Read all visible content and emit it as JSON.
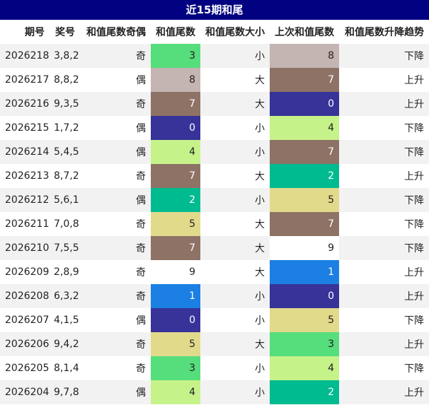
{
  "title": "近15期和尾",
  "headers": [
    "期号",
    "奖号",
    "和值尾数奇偶",
    "和值尾数",
    "和值尾数大小",
    "上次和值尾数",
    "和值尾数升降趋势"
  ],
  "digit_colors": {
    "0": "#373399",
    "1": "#1b7fe3",
    "2": "#00bb8f",
    "3": "#56dd7c",
    "4": "#c6f28a",
    "5": "#e2da8b",
    "7": "#8e7266",
    "8": "#c4b5b3",
    "9": "#ffffff"
  },
  "rows": [
    {
      "issue": "2026218",
      "numbers": "3,8,2",
      "parity": "奇",
      "tail": "3",
      "size": "小",
      "prev_tail": "8",
      "trend": "下降"
    },
    {
      "issue": "2026217",
      "numbers": "8,8,2",
      "parity": "偶",
      "tail": "8",
      "size": "大",
      "prev_tail": "7",
      "trend": "上升"
    },
    {
      "issue": "2026216",
      "numbers": "9,3,5",
      "parity": "奇",
      "tail": "7",
      "size": "大",
      "prev_tail": "0",
      "trend": "上升"
    },
    {
      "issue": "2026215",
      "numbers": "1,7,2",
      "parity": "偶",
      "tail": "0",
      "size": "小",
      "prev_tail": "4",
      "trend": "下降"
    },
    {
      "issue": "2026214",
      "numbers": "5,4,5",
      "parity": "偶",
      "tail": "4",
      "size": "小",
      "prev_tail": "7",
      "trend": "下降"
    },
    {
      "issue": "2026213",
      "numbers": "8,7,2",
      "parity": "奇",
      "tail": "7",
      "size": "大",
      "prev_tail": "2",
      "trend": "上升"
    },
    {
      "issue": "2026212",
      "numbers": "5,6,1",
      "parity": "偶",
      "tail": "2",
      "size": "小",
      "prev_tail": "5",
      "trend": "下降"
    },
    {
      "issue": "2026211",
      "numbers": "7,0,8",
      "parity": "奇",
      "tail": "5",
      "size": "大",
      "prev_tail": "7",
      "trend": "下降"
    },
    {
      "issue": "2026210",
      "numbers": "7,5,5",
      "parity": "奇",
      "tail": "7",
      "size": "大",
      "prev_tail": "9",
      "trend": "下降"
    },
    {
      "issue": "2026209",
      "numbers": "2,8,9",
      "parity": "奇",
      "tail": "9",
      "size": "大",
      "prev_tail": "1",
      "trend": "上升"
    },
    {
      "issue": "2026208",
      "numbers": "6,3,2",
      "parity": "奇",
      "tail": "1",
      "size": "小",
      "prev_tail": "0",
      "trend": "上升"
    },
    {
      "issue": "2026207",
      "numbers": "4,1,5",
      "parity": "偶",
      "tail": "0",
      "size": "小",
      "prev_tail": "5",
      "trend": "下降"
    },
    {
      "issue": "2026206",
      "numbers": "9,4,2",
      "parity": "奇",
      "tail": "5",
      "size": "大",
      "prev_tail": "3",
      "trend": "上升"
    },
    {
      "issue": "2026205",
      "numbers": "8,1,4",
      "parity": "奇",
      "tail": "3",
      "size": "小",
      "prev_tail": "4",
      "trend": "下降"
    },
    {
      "issue": "2026204",
      "numbers": "9,7,8",
      "parity": "偶",
      "tail": "4",
      "size": "小",
      "prev_tail": "2",
      "trend": "上升"
    }
  ]
}
